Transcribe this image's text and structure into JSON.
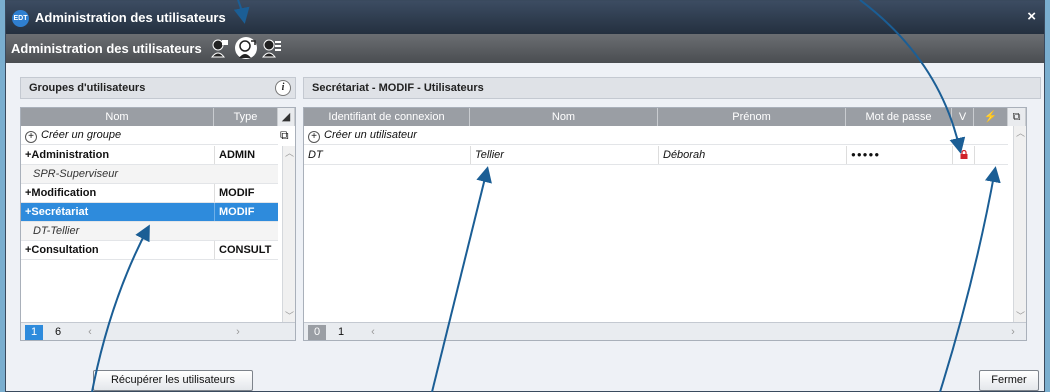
{
  "window": {
    "title": "Administration des utilisateurs",
    "close_glyph": "×",
    "logo_text": "EDT"
  },
  "toolbar": {
    "title": "Administration des utilisateurs",
    "icons": [
      "users-lock-icon",
      "user-connection-icon",
      "user-list-icon"
    ]
  },
  "groups_panel": {
    "title": "Groupes d'utilisateurs",
    "info_glyph": "i",
    "columns": {
      "name": "Nom",
      "type": "Type"
    },
    "create_label": "Créer un groupe",
    "rows": [
      {
        "name": "+Administration",
        "type": "ADMIN",
        "kind": "group"
      },
      {
        "name": "SPR-Superviseur",
        "type": "",
        "kind": "member"
      },
      {
        "name": "+Modification",
        "type": "MODIF",
        "kind": "group"
      },
      {
        "name": "+Secrétariat",
        "type": "MODIF",
        "kind": "selected"
      },
      {
        "name": "DT-Tellier",
        "type": "",
        "kind": "member"
      },
      {
        "name": "+Consultation",
        "type": "CONSULT",
        "kind": "group"
      }
    ],
    "pager": {
      "current": "1",
      "total": "6"
    }
  },
  "users_panel": {
    "title": "Secrétariat - MODIF - Utilisateurs",
    "columns": {
      "login": "Identifiant de connexion",
      "name": "Nom",
      "firstname": "Prénom",
      "password": "Mot de passe",
      "v": "V"
    },
    "create_label": "Créer un utilisateur",
    "rows": [
      {
        "login": "DT",
        "name": "Tellier",
        "firstname": "Déborah",
        "password": "●●●●●",
        "locked": true
      }
    ],
    "pager": {
      "current": "0",
      "total": "1"
    }
  },
  "buttons": {
    "retrieve": "Récupérer les utilisateurs",
    "close": "Fermer"
  },
  "colors": {
    "selection": "#2e8bdc",
    "titlebar": "#2d3a4c",
    "arrow": "#1b5e95",
    "lock": "#d0222a"
  }
}
